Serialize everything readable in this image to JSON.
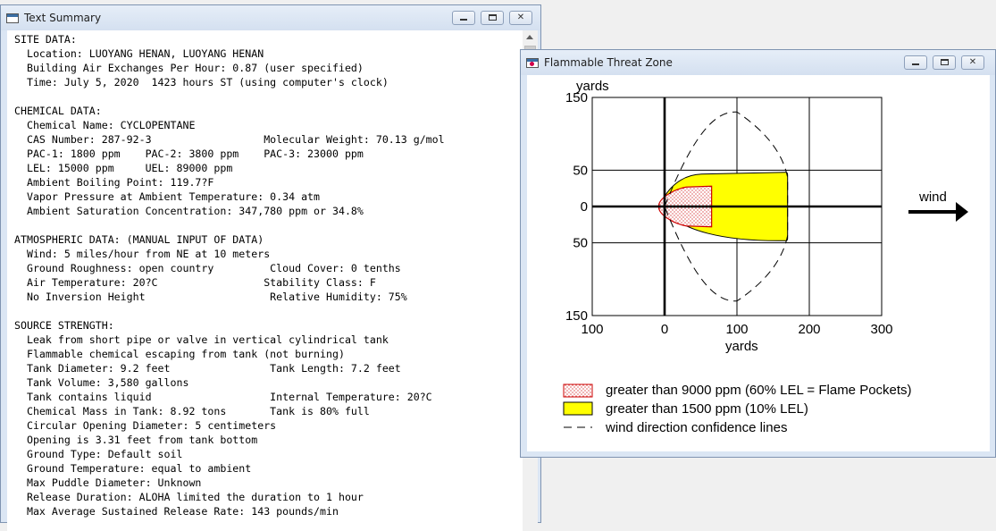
{
  "text_summary": {
    "title": "Text Summary",
    "lines": [
      "SITE DATA:",
      "  Location: LUOYANG HENAN, LUOYANG HENAN",
      "  Building Air Exchanges Per Hour: 0.87 (user specified)",
      "  Time: July 5, 2020  1423 hours ST (using computer's clock)",
      "",
      "CHEMICAL DATA:",
      "  Chemical Name: CYCLOPENTANE",
      "  CAS Number: 287-92-3                  Molecular Weight: 70.13 g/mol",
      "  PAC-1: 1800 ppm    PAC-2: 3800 ppm    PAC-3: 23000 ppm",
      "  LEL: 15000 ppm     UEL: 89000 ppm",
      "  Ambient Boiling Point: 119.7?F",
      "  Vapor Pressure at Ambient Temperature: 0.34 atm",
      "  Ambient Saturation Concentration: 347,780 ppm or 34.8%",
      "",
      "ATMOSPHERIC DATA: (MANUAL INPUT OF DATA)",
      "  Wind: 5 miles/hour from NE at 10 meters",
      "  Ground Roughness: open country         Cloud Cover: 0 tenths",
      "  Air Temperature: 20?C                 Stability Class: F",
      "  No Inversion Height                    Relative Humidity: 75%",
      "",
      "SOURCE STRENGTH:",
      "  Leak from short pipe or valve in vertical cylindrical tank",
      "  Flammable chemical escaping from tank (not burning)",
      "  Tank Diameter: 9.2 feet                Tank Length: 7.2 feet",
      "  Tank Volume: 3,580 gallons",
      "  Tank contains liquid                   Internal Temperature: 20?C",
      "  Chemical Mass in Tank: 8.92 tons       Tank is 80% full",
      "  Circular Opening Diameter: 5 centimeters",
      "  Opening is 3.31 feet from tank bottom",
      "  Ground Type: Default soil",
      "  Ground Temperature: equal to ambient",
      "  Max Puddle Diameter: Unknown",
      "  Release Duration: ALOHA limited the duration to 1 hour",
      "  Max Average Sustained Release Rate: 143 pounds/min"
    ]
  },
  "threat_zone": {
    "title": "Flammable Threat Zone",
    "y_unit": "yards",
    "x_unit": "yards",
    "y_ticks": [
      "150",
      "50",
      "0",
      "50",
      "150"
    ],
    "x_ticks": [
      "100",
      "0",
      "100",
      "200",
      "300"
    ],
    "wind_label": "wind",
    "legend": [
      {
        "label": "greater than 9000 ppm (60% LEL = Flame Pockets)",
        "swatch": "red-dotted"
      },
      {
        "label": "greater than 1500 ppm (10% LEL)",
        "swatch": "yellow"
      },
      {
        "label": "wind direction confidence lines",
        "swatch": "dashed"
      }
    ],
    "colors": {
      "zone_yellow": "#ffff00",
      "zone_red": "#cc0000"
    }
  },
  "chart_data": {
    "type": "area",
    "xlabel": "yards",
    "ylabel": "yards",
    "xlim": [
      -100,
      300
    ],
    "ylim": [
      -150,
      150
    ],
    "x_tick_values": [
      -100,
      0,
      100,
      200,
      300
    ],
    "y_tick_values": [
      150,
      50,
      0,
      -50,
      -150
    ],
    "series": [
      {
        "name": "greater than 9000 ppm (60% LEL = Flame Pockets)",
        "downwind_extent": 65,
        "max_half_width": 28
      },
      {
        "name": "greater than 1500 ppm (10% LEL)",
        "downwind_extent": 170,
        "max_half_width": 47
      }
    ],
    "confidence_lines": {
      "downwind_extent": 170,
      "max_half_width": 130
    },
    "grid": true
  }
}
